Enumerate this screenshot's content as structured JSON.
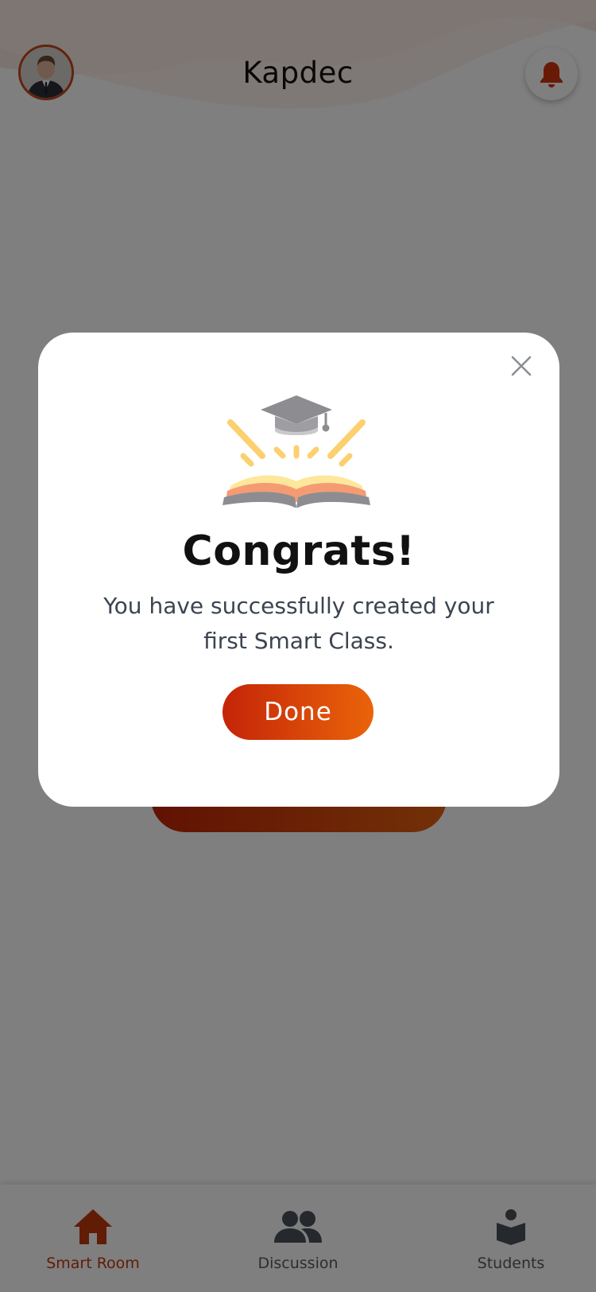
{
  "header": {
    "title": "Kapdec",
    "avatar_alt": "User avatar",
    "bell_icon": "bell-icon"
  },
  "modal": {
    "close_icon": "close-icon",
    "illustration_icon": "graduation-book-icon",
    "title": "Congrats!",
    "message_line1": "You have successfully created your",
    "message_line2": "first Smart Class.",
    "done_label": "Done"
  },
  "bottom_nav": {
    "items": [
      {
        "label": "Smart Room",
        "icon": "home-icon",
        "active": true
      },
      {
        "label": "Discussion",
        "icon": "people-icon",
        "active": false
      },
      {
        "label": "Students",
        "icon": "reader-icon",
        "active": false
      }
    ]
  },
  "colors": {
    "accent": "#c2390c",
    "accent_gradient_start": "#c42408",
    "accent_gradient_end": "#ea6409",
    "overlay": "rgba(0,0,0,0.5)",
    "text_muted": "#565b63"
  }
}
